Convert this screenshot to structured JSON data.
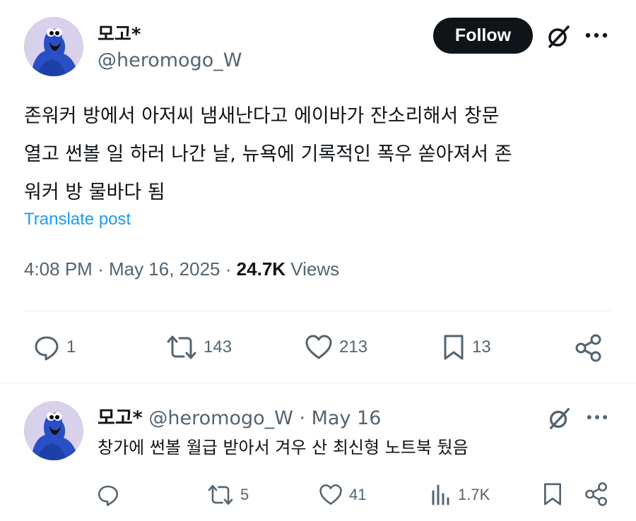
{
  "main_tweet": {
    "author_name": "모고*",
    "author_handle": "@heromogo_W",
    "follow_label": "Follow",
    "text_lines": [
      "존워커 방에서 아저씨 냄새난다고 에이바가 잔소리해서 창문",
      "열고 썬볼 일 하러 나간 날, 뉴욕에 기록적인 폭우 쏟아져서 존",
      "워커 방 물바다 됨"
    ],
    "translate_label": "Translate post",
    "time": "4:08 PM",
    "date": "May 16, 2025",
    "separator": "·",
    "views_count": "24.7K",
    "views_label": "Views",
    "actions": {
      "replies": "1",
      "reposts": "143",
      "likes": "213",
      "bookmarks": "13"
    },
    "icons": [
      "reply-icon",
      "repost-icon",
      "like-icon",
      "bookmark-icon",
      "share-icon",
      "grok-icon",
      "more-icon"
    ]
  },
  "reply_tweet": {
    "author_name": "모고*",
    "author_handle": "@heromogo_W",
    "separator": "·",
    "date": "May 16",
    "text": "창가에 썬볼 월급 받아서 겨우 산 최신형 노트북 뒀음",
    "actions": {
      "replies": "",
      "reposts": "5",
      "likes": "41",
      "views": "1.7K"
    }
  },
  "colors": {
    "text": "#0f1419",
    "secondary": "#536471",
    "link": "#1d9bf0",
    "follow_bg": "#0f1419",
    "avatar_bg": "#d9d0ec",
    "avatar_figure": "#2a4fc4"
  }
}
